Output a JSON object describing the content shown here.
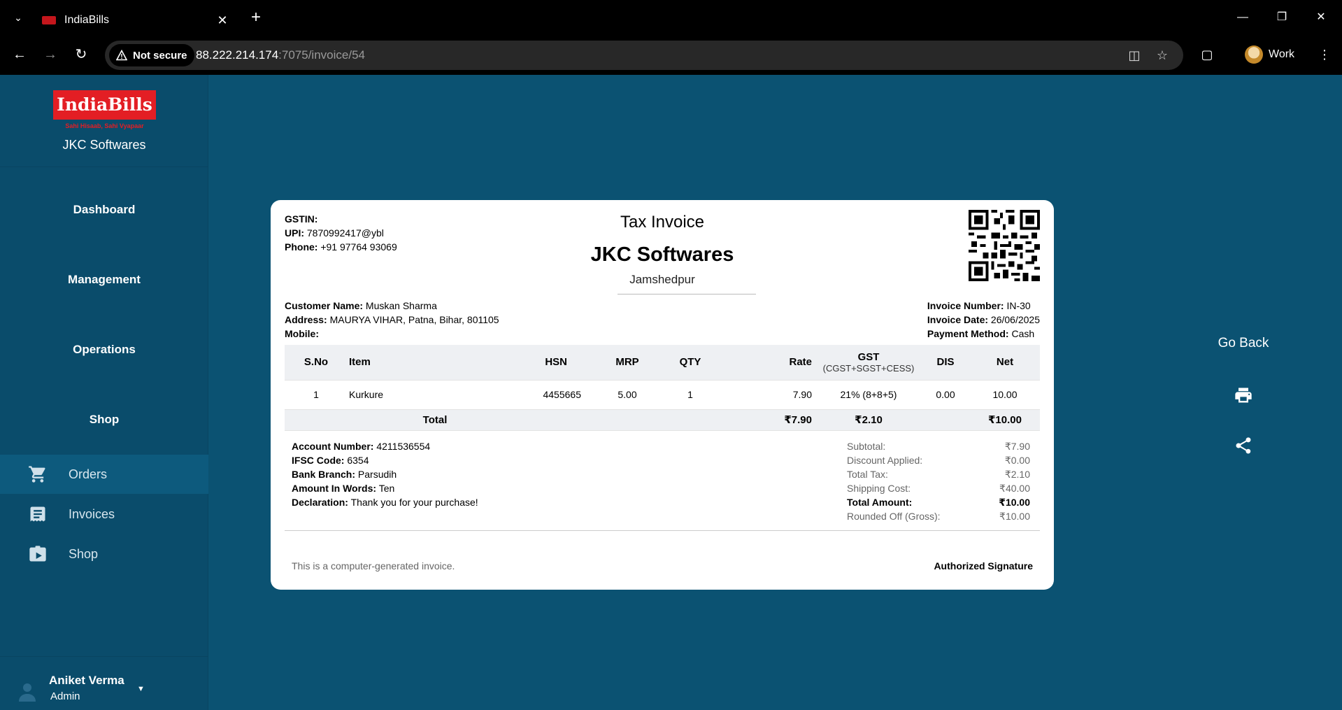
{
  "browser": {
    "tab_title": "IndiaBills",
    "security_label": "Not secure",
    "url_host": "88.222.214.174",
    "url_path": ":7075/invoice/54",
    "profile_name": "Work"
  },
  "sidebar": {
    "logo_text": "IndiaBills",
    "logo_tagline": "Sahi Hisaab, Sahi Vyapaar",
    "company": "JKC Softwares",
    "sections": [
      "Dashboard",
      "Management",
      "Operations",
      "Shop"
    ],
    "items": [
      {
        "label": "Orders",
        "icon": "cart-icon"
      },
      {
        "label": "Invoices",
        "icon": "receipt-icon"
      },
      {
        "label": "Shop",
        "icon": "store-icon"
      }
    ],
    "user": {
      "name": "Aniket Verma",
      "role": "Admin"
    }
  },
  "invoice": {
    "gstin_label": "GSTIN:",
    "gstin": "",
    "upi_label": "UPI:",
    "upi": "7870992417@ybl",
    "phone_label": "Phone:",
    "phone": "+91 97764 93069",
    "title": "Tax Invoice",
    "company": "JKC Softwares",
    "city": "Jamshedpur",
    "customer_name_label": "Customer Name:",
    "customer_name": "Muskan Sharma",
    "address_label": "Address:",
    "address": "MAURYA VIHAR, Patna, Bihar, 801105",
    "mobile_label": "Mobile:",
    "mobile": "",
    "number_label": "Invoice Number:",
    "number": "IN-30",
    "date_label": "Invoice Date:",
    "date": "26/06/2025",
    "payment_label": "Payment Method:",
    "payment": "Cash",
    "columns": {
      "sno": "S.No",
      "item": "Item",
      "hsn": "HSN",
      "mrp": "MRP",
      "qty": "QTY",
      "rate": "Rate",
      "gst": "GST",
      "gst_sub": "(CGST+SGST+CESS)",
      "dis": "DIS",
      "net": "Net"
    },
    "rows": [
      {
        "sno": "1",
        "item": "Kurkure",
        "hsn": "4455665",
        "mrp": "5.00",
        "qty": "1",
        "rate": "7.90",
        "gst": "21% (8+8+5)",
        "dis": "0.00",
        "net": "10.00"
      }
    ],
    "total_label": "Total",
    "total_rate": "₹7.90",
    "total_gst": "₹2.10",
    "total_net": "₹10.00",
    "account_label": "Account Number:",
    "account": "4211536554",
    "ifsc_label": "IFSC Code:",
    "ifsc": "6354",
    "branch_label": "Bank Branch:",
    "branch": "Parsudih",
    "words_label": "Amount In Words:",
    "words": "Ten",
    "declaration_label": "Declaration:",
    "declaration": "Thank you for your purchase!",
    "summary": [
      {
        "label": "Subtotal:",
        "value": "₹7.90",
        "strong": false
      },
      {
        "label": "Discount Applied:",
        "value": "₹0.00",
        "strong": false
      },
      {
        "label": "Total Tax:",
        "value": "₹2.10",
        "strong": false
      },
      {
        "label": "Shipping Cost:",
        "value": "₹40.00",
        "strong": false
      },
      {
        "label": "Total Amount:",
        "value": "₹10.00",
        "strong": true
      },
      {
        "label": "Rounded Off (Gross):",
        "value": "₹10.00",
        "strong": false
      }
    ],
    "footer_note": "This is a computer-generated invoice.",
    "signature": "Authorized Signature"
  },
  "actions": {
    "go_back": "Go Back",
    "print_icon": "print-icon",
    "share_icon": "share-icon"
  },
  "colors": {
    "page_bg": "#0b5272",
    "sidebar_bg": "#0a4c6b",
    "brand_red": "#e31e24"
  }
}
